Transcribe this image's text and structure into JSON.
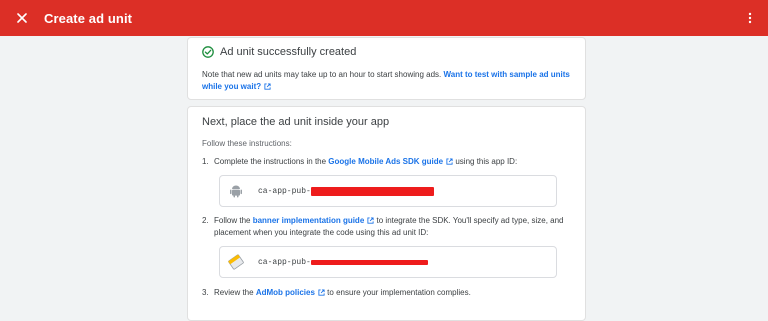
{
  "header": {
    "title": "Create ad unit",
    "bg_color": "#dc2f26"
  },
  "success_card": {
    "status_text": "Ad unit successfully created",
    "note_prefix": "Note that new ad units may take up to an hour to start showing ads.",
    "note_link": "Want to test with sample ad units while you wait?",
    "status_color": "#1e8e3e"
  },
  "instructions_card": {
    "title": "Next, place the ad unit inside your app",
    "follow": "Follow these instructions:",
    "steps": [
      {
        "number": "1.",
        "prefix": "Complete the instructions in the",
        "link": "Google Mobile Ads SDK guide",
        "suffix": "using this app ID:"
      },
      {
        "number": "2.",
        "prefix": "Follow the",
        "link": "banner implementation guide",
        "suffix": "to integrate the SDK. You'll specify ad type, size, and placement when you integrate the code using this ad unit ID:"
      },
      {
        "number": "3.",
        "prefix": "Review the",
        "link": "AdMob policies",
        "suffix": "to ensure your implementation complies."
      }
    ],
    "app_id_prefix": "ca-app-pub-",
    "ad_unit_id_prefix": "ca-app-pub-",
    "link_color": "#1a73e8"
  },
  "icons": [
    "close-icon",
    "more-vert-icon",
    "check-circle-icon",
    "external-link-icon",
    "android-icon",
    "ad-unit-banner-icon"
  ]
}
